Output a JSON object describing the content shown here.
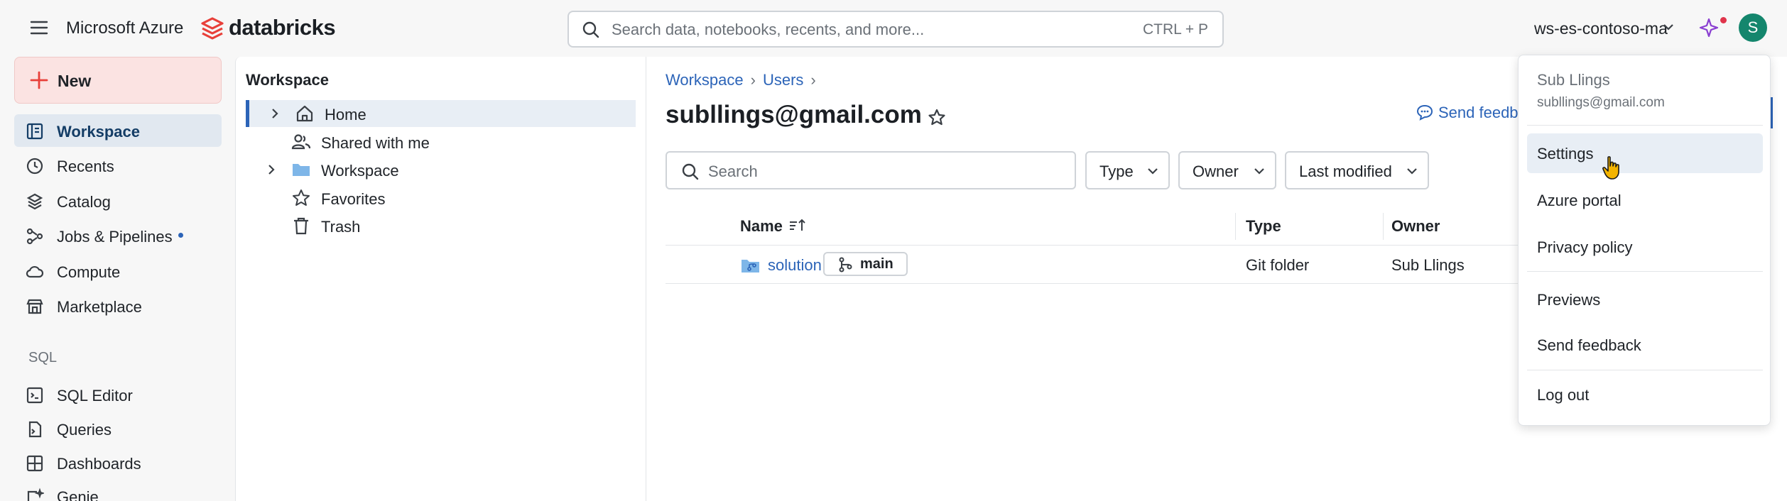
{
  "topbar": {
    "brand": "Microsoft Azure",
    "product": "databricks",
    "search_placeholder": "Search data, notebooks, recents, and more...",
    "search_shortcut": "CTRL + P",
    "workspace_name": "ws-es-contoso-ma",
    "avatar_initial": "S"
  },
  "sidebar": {
    "new_label": "New",
    "items": [
      {
        "label": "Workspace",
        "icon": "workspace-icon",
        "active": true
      },
      {
        "label": "Recents",
        "icon": "clock-icon"
      },
      {
        "label": "Catalog",
        "icon": "catalog-icon"
      },
      {
        "label": "Jobs & Pipelines",
        "icon": "jobs-icon",
        "badge_dot": true
      },
      {
        "label": "Compute",
        "icon": "cloud-icon"
      },
      {
        "label": "Marketplace",
        "icon": "store-icon"
      }
    ],
    "section_sql": "SQL",
    "sql_items": [
      {
        "label": "SQL Editor",
        "icon": "sql-editor-icon"
      },
      {
        "label": "Queries",
        "icon": "queries-icon"
      },
      {
        "label": "Dashboards",
        "icon": "dashboard-icon"
      },
      {
        "label": "Genie",
        "icon": "genie-icon"
      }
    ]
  },
  "tree": {
    "title": "Workspace",
    "items": [
      {
        "label": "Home",
        "icon": "home-icon",
        "expandable": true,
        "active": true
      },
      {
        "label": "Shared with me",
        "icon": "users-icon",
        "expandable": false
      },
      {
        "label": "Workspace",
        "icon": "folder-icon",
        "expandable": true
      },
      {
        "label": "Favorites",
        "icon": "star-icon",
        "expandable": false
      },
      {
        "label": "Trash",
        "icon": "trash-icon",
        "expandable": false
      }
    ]
  },
  "content": {
    "breadcrumb": [
      "Workspace",
      "Users"
    ],
    "title": "subllings@gmail.com",
    "send_feedback": "Send feedb",
    "search_placeholder": "Search",
    "filters": [
      "Type",
      "Owner",
      "Last modified"
    ],
    "columns": [
      "Name",
      "Type",
      "Owner"
    ],
    "rows": [
      {
        "name": "solution",
        "branch": "main",
        "type": "Git folder",
        "owner": "Sub Llings"
      }
    ]
  },
  "menu": {
    "user_name": "Sub Llings",
    "user_email": "subllings@gmail.com",
    "items": [
      "Settings",
      "Azure portal",
      "Privacy policy",
      "Previews",
      "Send feedback",
      "Log out"
    ],
    "hovered": "Settings"
  },
  "colors": {
    "accent": "#2c64b8",
    "new_button_bg": "#fbe3e2",
    "avatar_bg": "#14866d",
    "brand_red": "#e8403a"
  }
}
